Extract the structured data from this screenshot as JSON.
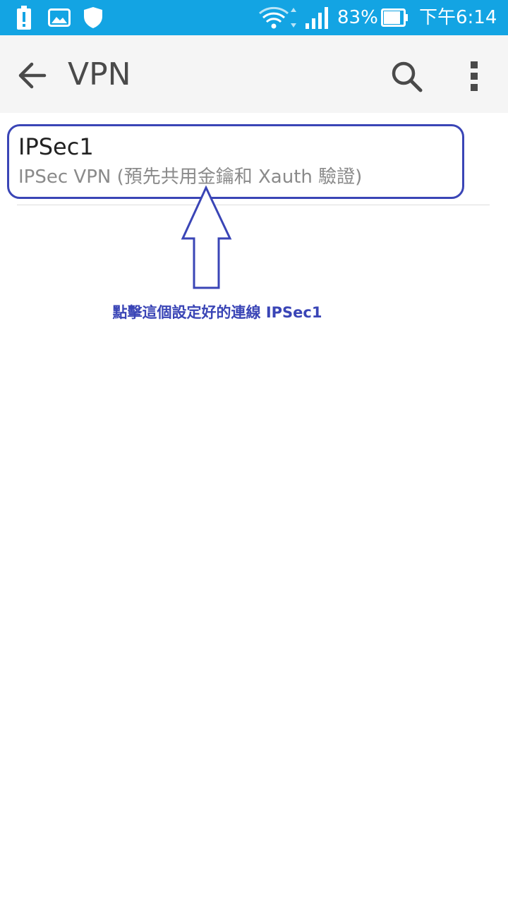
{
  "status_bar": {
    "battery_percent": "83%",
    "time": "下午6:14",
    "icons": [
      "alert-icon",
      "image-icon",
      "shield-icon",
      "wifi-icon",
      "signal-icon",
      "battery-icon"
    ],
    "background": "#13a4e3"
  },
  "app_bar": {
    "title": "VPN",
    "icons": [
      "back-arrow-icon",
      "search-icon",
      "more-vert-icon"
    ]
  },
  "vpn_list": [
    {
      "name": "IPSec1",
      "summary": "IPSec VPN (預先共用金鑰和 Xauth 驗證)"
    }
  ],
  "annotation": {
    "text": "點擊這個設定好的連線 IPSec1",
    "color": "#3a45b6"
  }
}
